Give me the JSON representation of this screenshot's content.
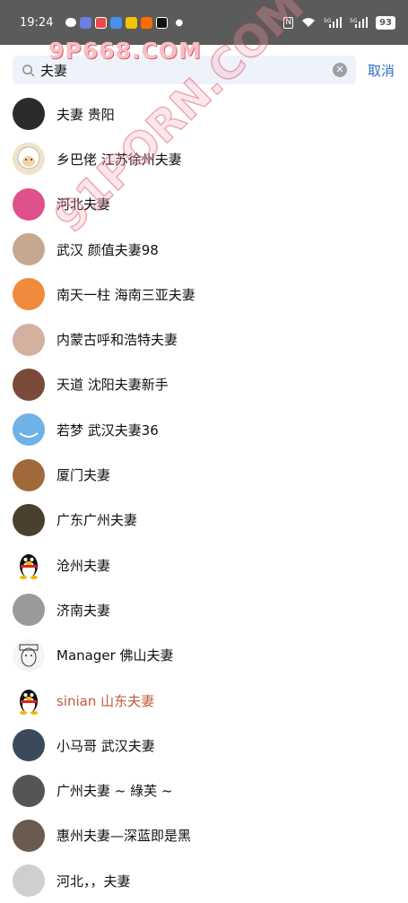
{
  "status_bar": {
    "time": "19:24",
    "battery": "93",
    "signal_icons": [
      "nfc-icon",
      "wifi-icon",
      "signal-5g-icon",
      "signal-5g-icon",
      "battery-icon"
    ],
    "app_icons": [
      "wechat-icon",
      "app-icon-blue",
      "app-icon-red",
      "qq-icon",
      "app-icon-yellow",
      "taobao-icon",
      "tiktok-icon"
    ]
  },
  "watermark": {
    "top": "9P668.COM",
    "diagonal": "91PORN.COM"
  },
  "search": {
    "query": "夫妻",
    "cancel_label": "取消"
  },
  "results": [
    {
      "name": "夫妻  贵阳",
      "avatar": "avatar-dark-blur",
      "color": "#2b2b2b"
    },
    {
      "name": "乡巴佬 江苏徐州夫妻",
      "avatar": "avatar-sheep-cartoon",
      "color": "#f0e3c8"
    },
    {
      "name": "河北夫妻",
      "avatar": "avatar-pink",
      "color": "#e0508a"
    },
    {
      "name": "武汉 颜值夫妻98",
      "avatar": "avatar-woman-photo",
      "color": "#c7a88e"
    },
    {
      "name": "南天一柱 海南三亚夫妻",
      "avatar": "avatar-orange",
      "color": "#f08a3c"
    },
    {
      "name": "内蒙古呼和浩特夫妻",
      "avatar": "avatar-feet",
      "color": "#d4b0a0"
    },
    {
      "name": "天道 沈阳夫妻新手",
      "avatar": "avatar-woman-long-hair",
      "color": "#7a4a3a"
    },
    {
      "name": "若梦 武汉夫妻36",
      "avatar": "avatar-blue-sky",
      "color": "#6fb2e8"
    },
    {
      "name": "厦门夫妻",
      "avatar": "avatar-dog",
      "color": "#a06a3a"
    },
    {
      "name": "广东广州夫妻",
      "avatar": "avatar-dark-photo",
      "color": "#4a4030"
    },
    {
      "name": "沧州夫妻",
      "avatar": "avatar-qq-penguin",
      "color": "#ffffff"
    },
    {
      "name": "济南夫妻",
      "avatar": "avatar-grey",
      "color": "#9a9a9a"
    },
    {
      "name": "Manager 佛山夫妻",
      "avatar": "avatar-sketch",
      "color": "#f4f4f4"
    },
    {
      "name": "sinian  山东夫妻",
      "avatar": "avatar-qq-penguin",
      "color": "#ffffff",
      "highlight": true
    },
    {
      "name": "小马哥 武汉夫妻",
      "avatar": "avatar-hands",
      "color": "#3a4a5a"
    },
    {
      "name": "广州夫妻 ~ 綠芙 ~",
      "avatar": "avatar-bw-photo",
      "color": "#555555"
    },
    {
      "name": "惠州夫妻—深蓝即是黑",
      "avatar": "avatar-woman-photo-2",
      "color": "#6a5a50"
    },
    {
      "name": "河北，，夫妻",
      "avatar": "avatar-light-photo",
      "color": "#cfcfcf"
    }
  ]
}
